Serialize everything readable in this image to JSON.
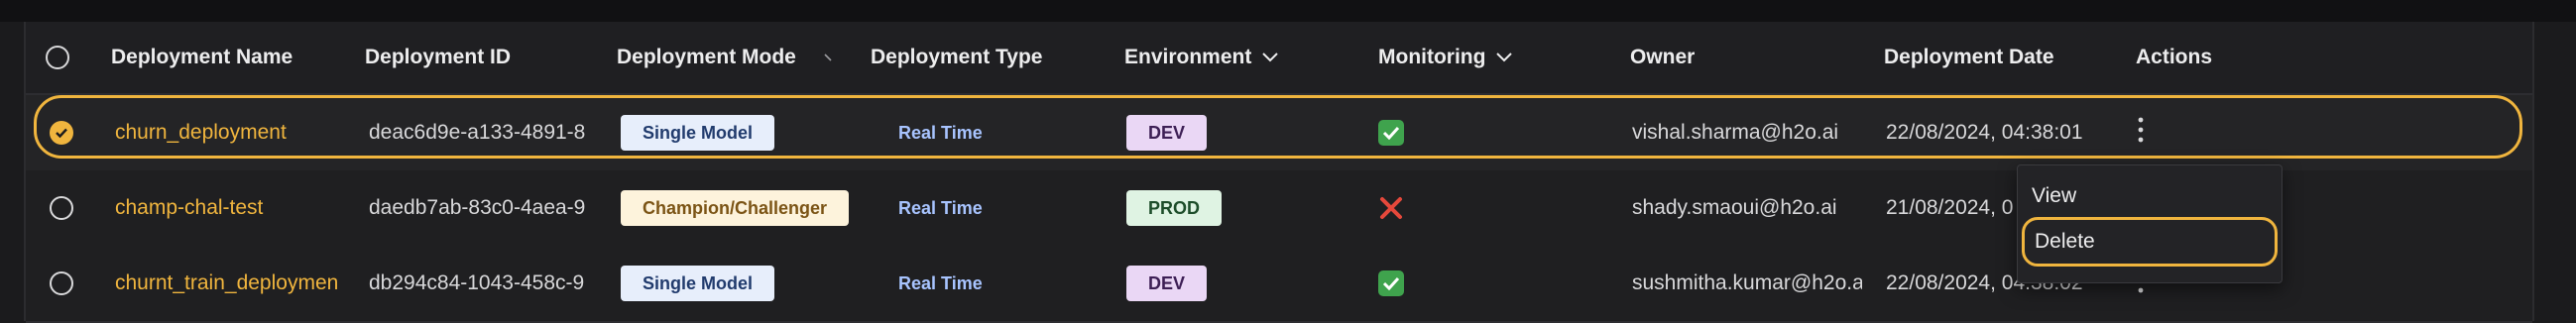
{
  "header": {
    "columns": {
      "name": "Deployment Name",
      "id": "Deployment ID",
      "mode": "Deployment Mode",
      "type": "Deployment Type",
      "env": "Environment",
      "monitoring": "Monitoring",
      "owner": "Owner",
      "date": "Deployment Date",
      "actions": "Actions"
    }
  },
  "rows": [
    {
      "selected": true,
      "name": "churn_deployment",
      "id": "deac6d9e-a133-4891-8",
      "mode": "Single Model",
      "type": "Real Time",
      "env": "DEV",
      "monitoring": "enabled",
      "owner": "vishal.sharma@h2o.ai",
      "date": "22/08/2024, 04:38:01"
    },
    {
      "selected": false,
      "name": "champ-chal-test",
      "id": "daedb7ab-83c0-4aea-9",
      "mode": "Champion/Challenger",
      "type": "Real Time",
      "env": "PROD",
      "monitoring": "disabled",
      "owner": "shady.smaoui@h2o.ai",
      "date": "21/08/2024, 0"
    },
    {
      "selected": false,
      "name": "churnt_train_deploymen",
      "id": "db294c84-1043-458c-9",
      "mode": "Single Model",
      "type": "Real Time",
      "env": "DEV",
      "monitoring": "enabled",
      "owner": "sushmitha.kumar@h2o.a",
      "date": "22/08/2024, 04:38:02"
    }
  ],
  "actions_menu": {
    "items": [
      "View",
      "Delete"
    ],
    "highlighted": "Delete"
  },
  "icons": {
    "monitor_ok": "check-mark-icon",
    "monitor_off": "cross-mark-icon",
    "kebab": "more-vertical-icon",
    "sort_desc": "chevron-down-icon"
  },
  "colors": {
    "accent": "#f0b53e",
    "background": "#1b1b1d",
    "ok_green": "#3fa34d",
    "error_red": "#e5483b"
  }
}
